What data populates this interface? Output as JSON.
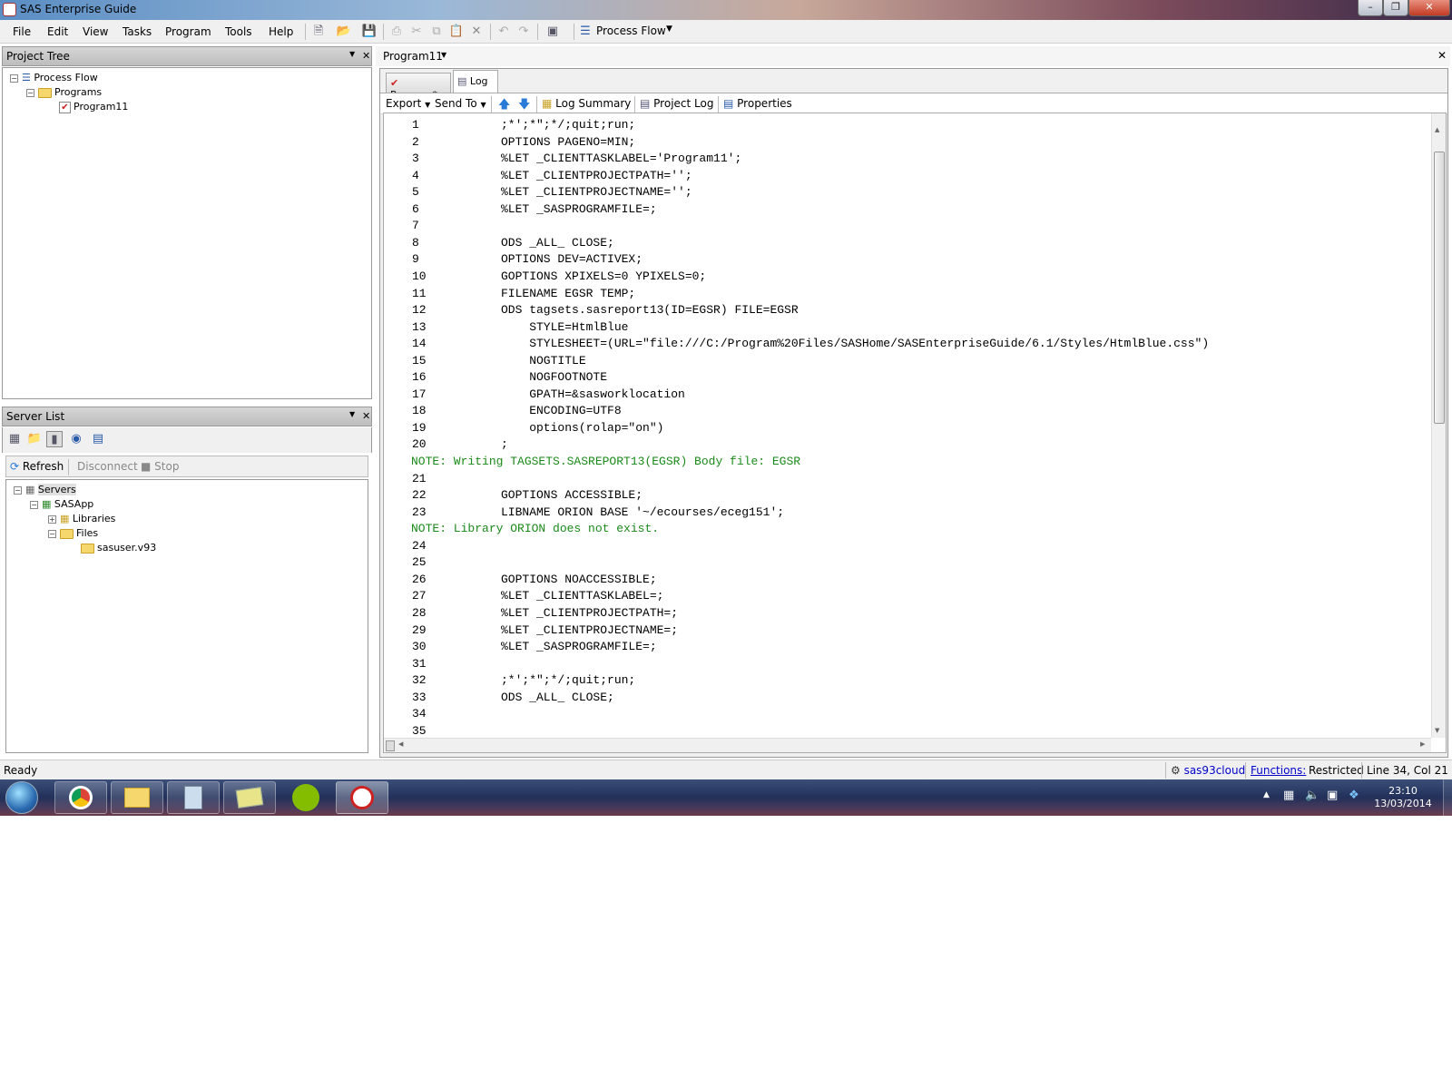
{
  "window": {
    "title": "SAS Enterprise Guide"
  },
  "menu": [
    "File",
    "Edit",
    "View",
    "Tasks",
    "Program",
    "Tools",
    "Help"
  ],
  "toolbar": {
    "process_flow_label": "Process Flow"
  },
  "project_tree": {
    "title": "Project Tree",
    "items": [
      {
        "label": "Process Flow"
      },
      {
        "label": "Programs"
      },
      {
        "label": "Program11"
      }
    ]
  },
  "server_list": {
    "title": "Server List",
    "buttons": {
      "refresh": "Refresh",
      "disconnect": "Disconnect",
      "stop": "Stop"
    },
    "items": [
      {
        "label": "Servers"
      },
      {
        "label": "SASApp"
      },
      {
        "label": "Libraries"
      },
      {
        "label": "Files"
      },
      {
        "label": "sasuser.v93"
      }
    ]
  },
  "document": {
    "title": "Program11",
    "tabs": [
      {
        "label": "Program*"
      },
      {
        "label": "Log"
      }
    ],
    "log_toolbar": {
      "export": "Export",
      "send_to": "Send To",
      "log_summary": "Log Summary",
      "project_log": "Project Log",
      "properties": "Properties"
    }
  },
  "log_lines": [
    {
      "n": "1",
      "t": ";*';*\";*/;quit;run;"
    },
    {
      "n": "2",
      "t": "OPTIONS PAGENO=MIN;"
    },
    {
      "n": "3",
      "t": "%LET _CLIENTTASKLABEL='Program11';"
    },
    {
      "n": "4",
      "t": "%LET _CLIENTPROJECTPATH='';"
    },
    {
      "n": "5",
      "t": "%LET _CLIENTPROJECTNAME='';"
    },
    {
      "n": "6",
      "t": "%LET _SASPROGRAMFILE=;"
    },
    {
      "n": "7",
      "t": ""
    },
    {
      "n": "8",
      "t": "ODS _ALL_ CLOSE;"
    },
    {
      "n": "9",
      "t": "OPTIONS DEV=ACTIVEX;"
    },
    {
      "n": "10",
      "t": "GOPTIONS XPIXELS=0 YPIXELS=0;"
    },
    {
      "n": "11",
      "t": "FILENAME EGSR TEMP;"
    },
    {
      "n": "12",
      "t": "ODS tagsets.sasreport13(ID=EGSR) FILE=EGSR"
    },
    {
      "n": "13",
      "t": "    STYLE=HtmlBlue"
    },
    {
      "n": "14",
      "t": "    STYLESHEET=(URL=\"file:///C:/Program%20Files/SASHome/SASEnterpriseGuide/6.1/Styles/HtmlBlue.css\")"
    },
    {
      "n": "15",
      "t": "    NOGTITLE"
    },
    {
      "n": "16",
      "t": "    NOGFOOTNOTE"
    },
    {
      "n": "17",
      "t": "    GPATH=&sasworklocation"
    },
    {
      "n": "18",
      "t": "    ENCODING=UTF8"
    },
    {
      "n": "19",
      "t": "    options(rolap=\"on\")"
    },
    {
      "n": "20",
      "t": ";"
    },
    {
      "n": "",
      "t": "NOTE: Writing TAGSETS.SASREPORT13(EGSR) Body file: EGSR",
      "note": true
    },
    {
      "n": "21",
      "t": ""
    },
    {
      "n": "22",
      "t": "GOPTIONS ACCESSIBLE;"
    },
    {
      "n": "23",
      "t": "LIBNAME ORION BASE '~/ecourses/eceg151';"
    },
    {
      "n": "",
      "t": "NOTE: Library ORION does not exist.",
      "note": true
    },
    {
      "n": "24",
      "t": ""
    },
    {
      "n": "25",
      "t": ""
    },
    {
      "n": "26",
      "t": "GOPTIONS NOACCESSIBLE;"
    },
    {
      "n": "27",
      "t": "%LET _CLIENTTASKLABEL=;"
    },
    {
      "n": "28",
      "t": "%LET _CLIENTPROJECTPATH=;"
    },
    {
      "n": "29",
      "t": "%LET _CLIENTPROJECTNAME=;"
    },
    {
      "n": "30",
      "t": "%LET _SASPROGRAMFILE=;"
    },
    {
      "n": "31",
      "t": ""
    },
    {
      "n": "32",
      "t": ";*';*\";*/;quit;run;"
    },
    {
      "n": "33",
      "t": "ODS _ALL_ CLOSE;"
    },
    {
      "n": "34",
      "t": ""
    },
    {
      "n": "35",
      "t": ""
    }
  ],
  "status": {
    "left": "Ready",
    "server": "sas93cloud",
    "functions_label": "Functions:",
    "functions_value": "Restricted",
    "position": "Line 34, Col 21"
  },
  "taskbar": {
    "time": "23:10",
    "date": "13/03/2014"
  },
  "colors": {
    "note_text": "#1a8a1a",
    "link": "#0000cc"
  }
}
